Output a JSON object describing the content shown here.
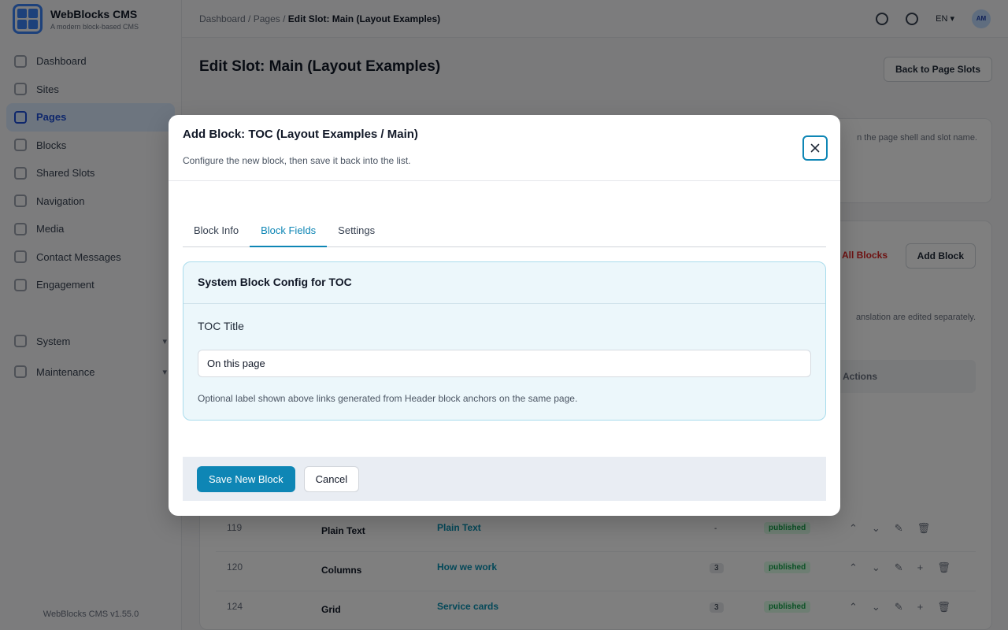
{
  "app": {
    "name": "WebBlocks CMS",
    "tagline": "A modern block-based CMS",
    "version": "WebBlocks CMS v1.55.0"
  },
  "sidebar": {
    "items": [
      {
        "label": "Dashboard",
        "icon": "dashboard-icon"
      },
      {
        "label": "Sites",
        "icon": "globe-icon"
      },
      {
        "label": "Pages",
        "icon": "page-icon",
        "active": true
      },
      {
        "label": "Blocks",
        "icon": "blocks-icon"
      },
      {
        "label": "Shared Slots",
        "icon": "layers-icon"
      },
      {
        "label": "Navigation",
        "icon": "menu-icon"
      },
      {
        "label": "Media",
        "icon": "image-icon"
      },
      {
        "label": "Contact Messages",
        "icon": "mail-icon"
      },
      {
        "label": "Engagement",
        "icon": "star-icon"
      }
    ],
    "groups": [
      {
        "label": "System",
        "icon": "gear-icon"
      },
      {
        "label": "Maintenance",
        "icon": "file-icon"
      }
    ]
  },
  "topbar": {
    "breadcrumb": [
      "Dashboard",
      "Pages",
      "Edit Slot: Main (Layout Examples)"
    ],
    "language": "EN",
    "avatar_initials": "AM"
  },
  "page": {
    "title": "Edit Slot: Main (Layout Examples)",
    "back_button": "Back to Page Slots",
    "info_text": "n the page shell and slot name.",
    "delete_all": "All Blocks",
    "add_block": "Add Block",
    "translation_note": "anslation are edited separately.",
    "actions_header": "Actions",
    "rows": [
      {
        "id": "119",
        "name": "Plain Text",
        "label": "Plain Text",
        "count": "-",
        "status": "published"
      },
      {
        "id": "120",
        "name": "Columns",
        "label": "How we work",
        "count": "3",
        "status": "published"
      },
      {
        "id": "124",
        "name": "Grid",
        "label": "Service cards",
        "count": "3",
        "status": "published"
      }
    ]
  },
  "modal": {
    "title": "Add Block: TOC (Layout Examples / Main)",
    "subtitle": "Configure the new block, then save it back into the list.",
    "tabs": [
      {
        "label": "Block Info"
      },
      {
        "label": "Block Fields",
        "active": true
      },
      {
        "label": "Settings"
      }
    ],
    "config": {
      "heading": "System Block Config for TOC",
      "field_label": "TOC Title",
      "field_value": "On this page",
      "help_text": "Optional label shown above links generated from Header block anchors on the same page."
    },
    "save_label": "Save New Block",
    "cancel_label": "Cancel"
  },
  "colors": {
    "accent": "#0e86b5",
    "overlay": "rgba(0,0,0,0.5)",
    "config_bg": "#ecf7fb"
  }
}
